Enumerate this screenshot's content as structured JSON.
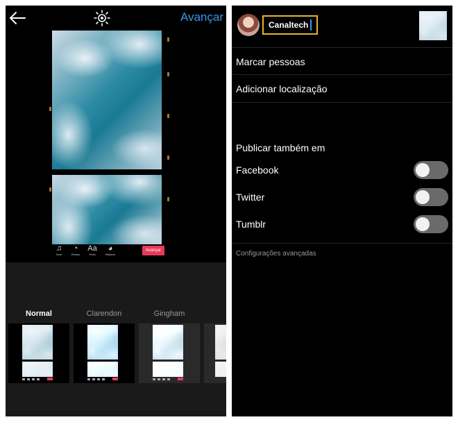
{
  "left": {
    "next_label": "Avançar",
    "editor_tools": [
      {
        "icon": "music-icon",
        "glyph": "♫",
        "label": "Som"
      },
      {
        "icon": "effects-icon",
        "glyph": "◔",
        "label": "Efeitos"
      },
      {
        "icon": "text-icon",
        "glyph": "Aa",
        "label": "Texto"
      },
      {
        "icon": "stickers-icon",
        "glyph": "◕",
        "label": "Stickers"
      }
    ],
    "editor_next_label": "Avançar",
    "filters": [
      {
        "name": "Normal",
        "active": true
      },
      {
        "name": "Clarendon",
        "active": false
      },
      {
        "name": "Gingham",
        "active": false
      }
    ]
  },
  "right": {
    "caption_value": "Canaltech",
    "tag_people": "Marcar pessoas",
    "add_location": "Adicionar localização",
    "share_also_header": "Publicar também em",
    "share_targets": [
      {
        "label": "Facebook",
        "enabled": false
      },
      {
        "label": "Twitter",
        "enabled": false
      },
      {
        "label": "Tumblr",
        "enabled": false
      }
    ],
    "advanced_settings": "Configurações avançadas"
  },
  "colors": {
    "accent_blue": "#3897f0",
    "highlight_box": "#e6b430",
    "toggle_off": "#6a6a6a",
    "editor_next_red": "#e8395a"
  }
}
